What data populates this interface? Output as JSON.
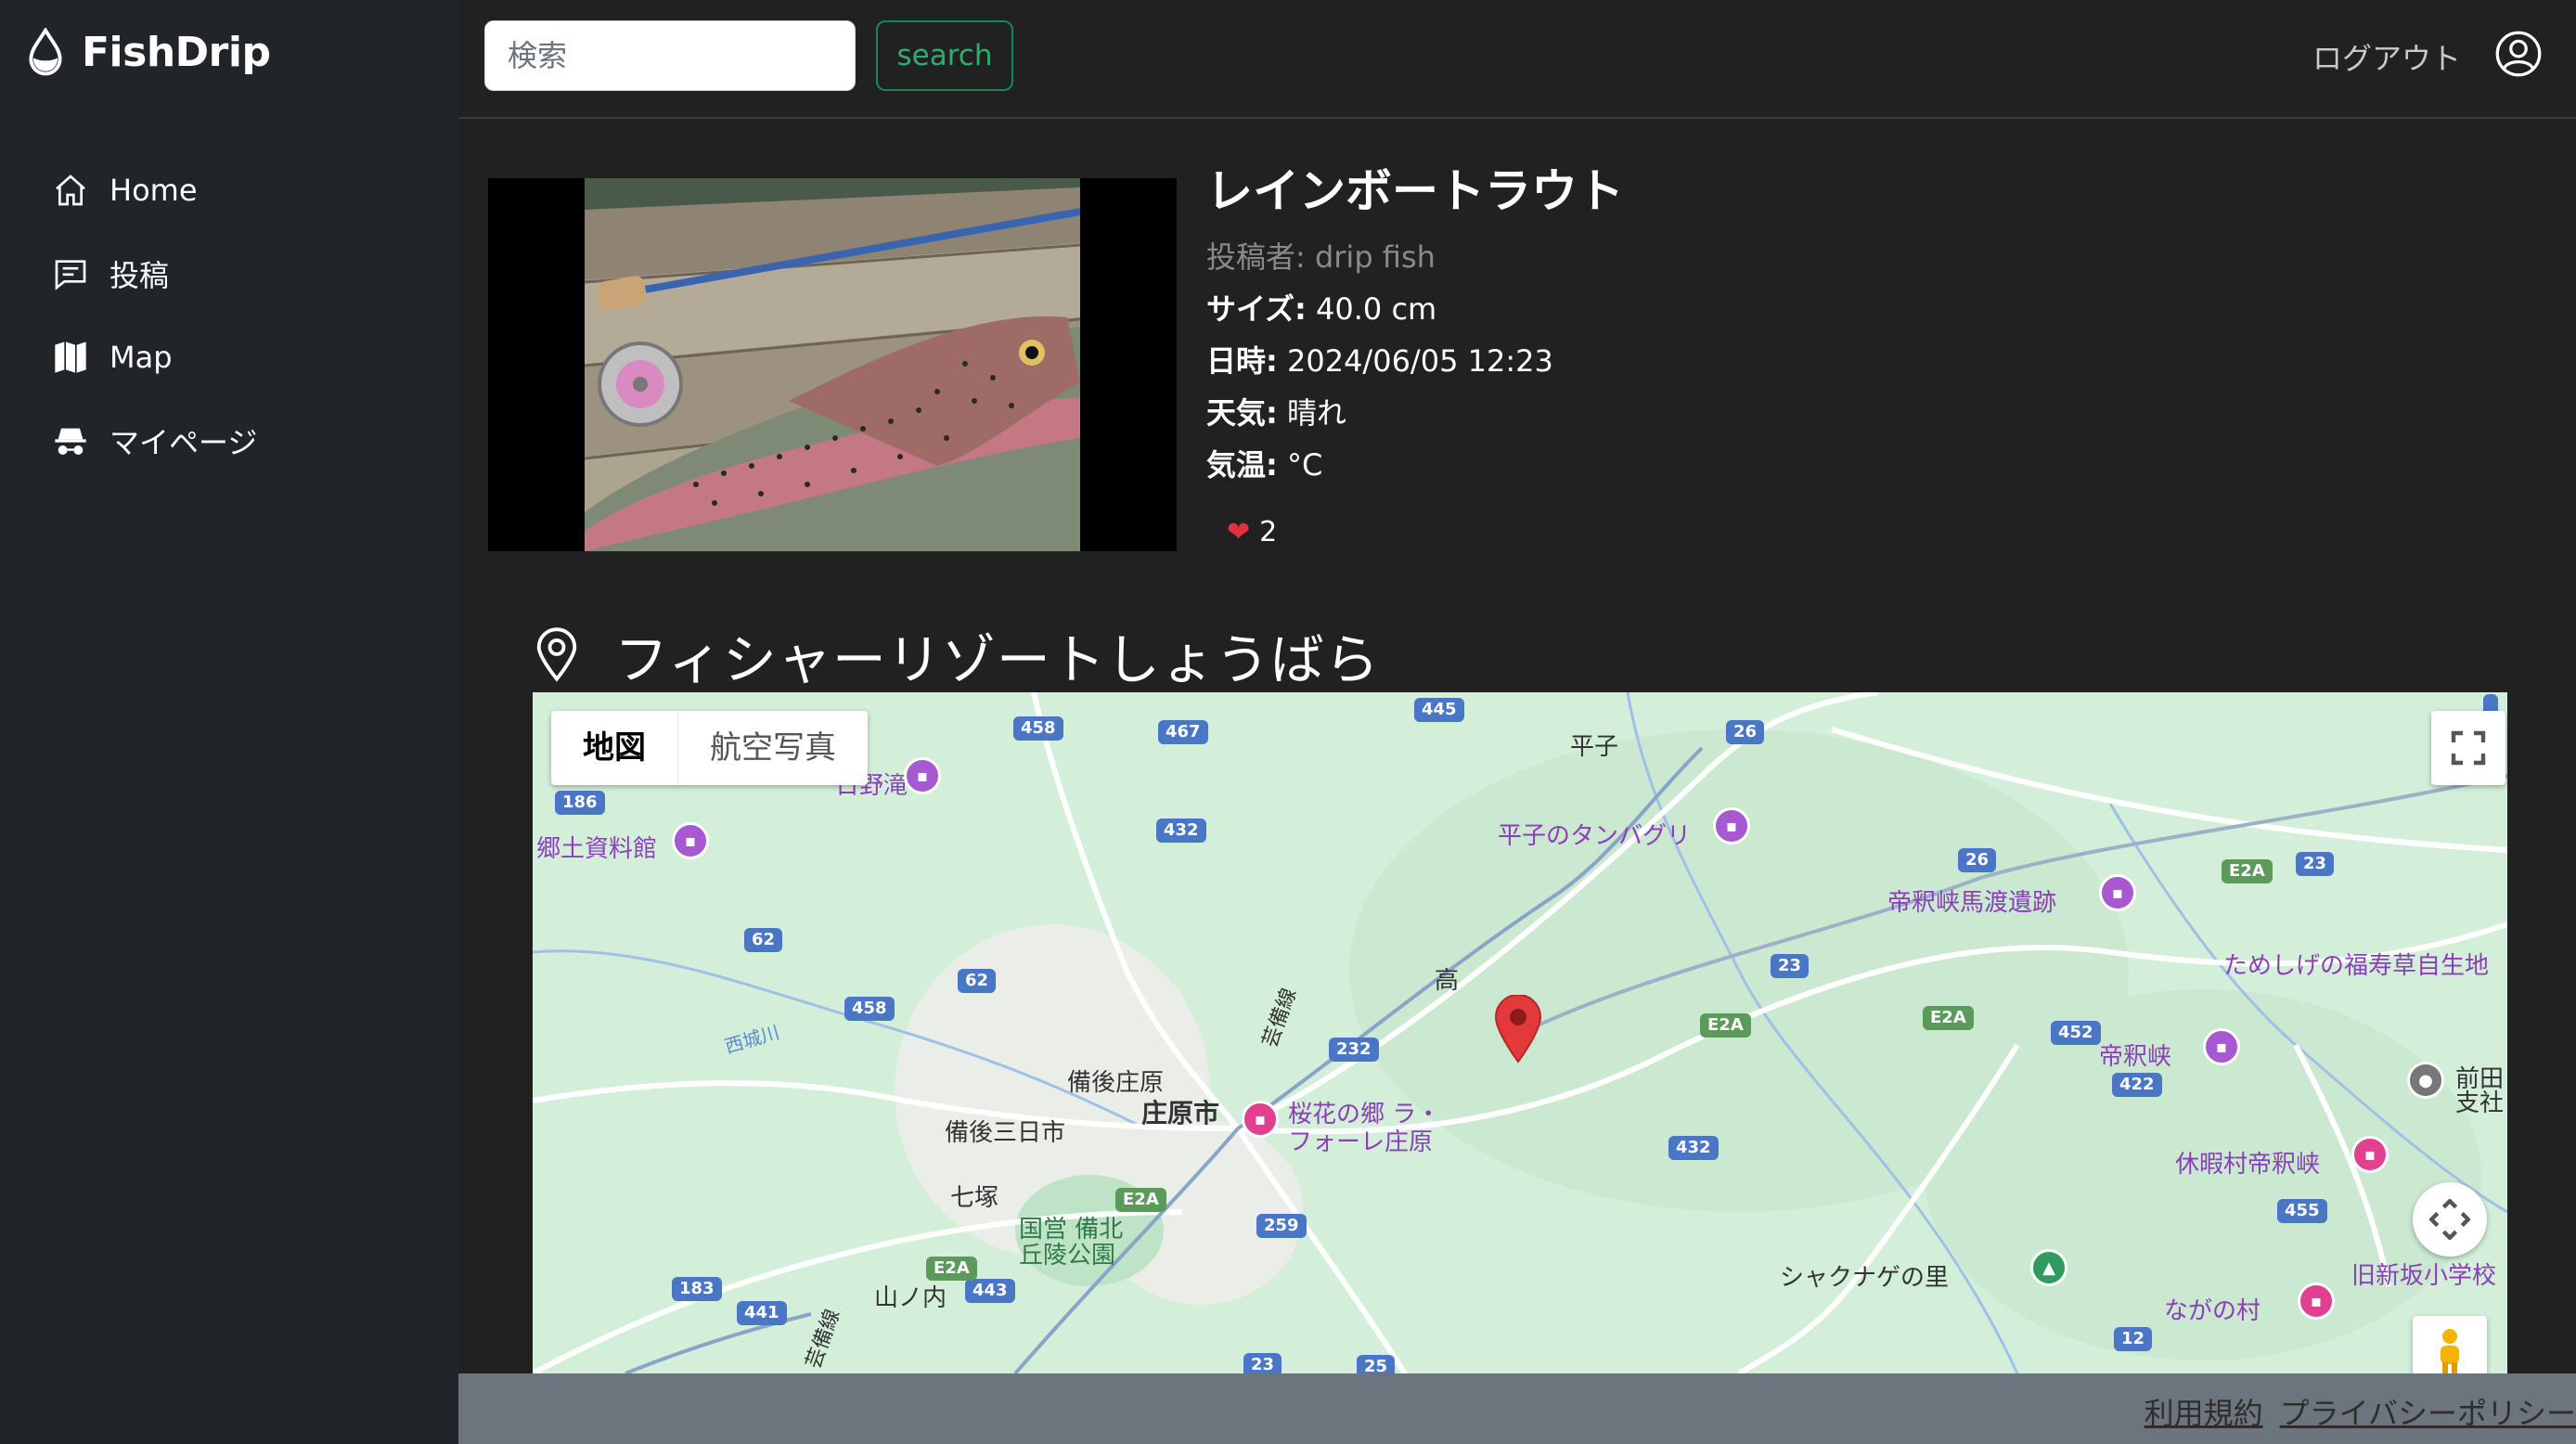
{
  "brand": {
    "name": "FishDrip"
  },
  "sidebar": {
    "items": [
      {
        "label": "Home"
      },
      {
        "label": "投稿"
      },
      {
        "label": "Map"
      },
      {
        "label": "マイページ"
      }
    ]
  },
  "header": {
    "search_placeholder": "検索",
    "search_button": "search",
    "logout": "ログアウト"
  },
  "post": {
    "title": "レインボートラウト",
    "author": "投稿者: drip fish",
    "size_label": "サイズ:",
    "size_value": "40.0 cm",
    "date_label": "日時:",
    "date_value": "2024/06/05 12:23",
    "weather_label": "天気:",
    "weather_value": "晴れ",
    "temp_label": "気温:",
    "temp_value": "°C",
    "likes": "2"
  },
  "location": {
    "name": "フィシャーリゾートしょうばら"
  },
  "map": {
    "type_map": "地図",
    "type_satellite": "航空写真",
    "labels": {
      "hino": "日野滝",
      "kyodo": "郷土資料館",
      "hirako": "平子",
      "tanbaguri": "平子のタンバグリ",
      "taishaku_iseki": "帝釈峡馬渡遺跡",
      "tameshige": "ためしげの福寿草自生地",
      "taka": "高",
      "bingo_shobara": "備後庄原",
      "shobara": "庄原市",
      "bingo_miyoshi": "備後三日市",
      "ouka": "桜花の郷 ラ・",
      "ouka2": "フォーレ庄原",
      "nanatsuka": "七塚",
      "park1": "国営 備北",
      "park2": "丘陵公園",
      "yamanouchi": "山ノ内",
      "shakunage": "シャクナゲの里",
      "taishakukyo": "帝釈峡",
      "maeda1": "前田",
      "maeda2": "支社",
      "kyuka": "休暇村帝釈峡",
      "kyushinsaka": "旧新坂小学校",
      "nagano": "ながの村",
      "saijogawa": "西城川",
      "geibi1": "芸備線",
      "geibi2": "芸備線"
    },
    "routes": [
      "445",
      "467",
      "458",
      "26",
      "186",
      "432",
      "26",
      "23",
      "62",
      "62",
      "458",
      "232",
      "23",
      "452",
      "422",
      "432",
      "259",
      "455",
      "183",
      "441",
      "443",
      "23",
      "25",
      "12"
    ],
    "expressway": "E2A"
  },
  "footer": {
    "terms": "利用規約",
    "privacy": "プライバシーポリシー"
  }
}
